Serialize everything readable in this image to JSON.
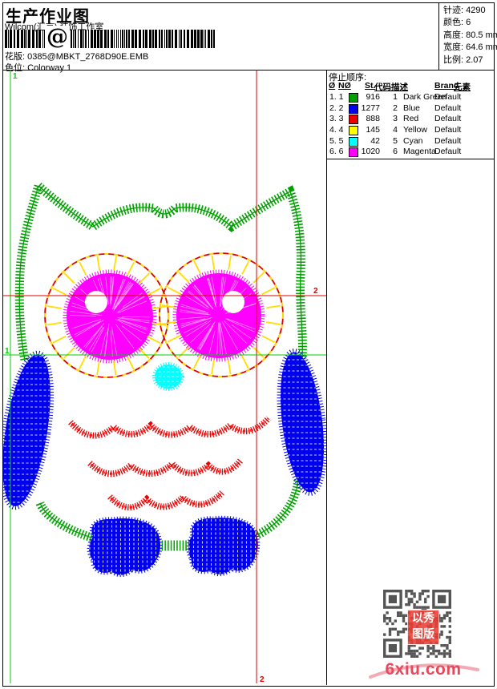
{
  "header": {
    "title": "生产作业图",
    "studio": "Wilcom(汇京) 装饰工作室",
    "barcode_text": "@",
    "pattern": {
      "label": "花版:",
      "value": "0385@MBKT_2768D90E.EMB"
    },
    "colorway": {
      "label": "色位:",
      "value": "Colorway 1"
    },
    "stats": [
      "针迹: 4290",
      "颜色: 6",
      "高度: 80.5 mm",
      "宽度: 64.6 mm",
      "比例: 2.07"
    ]
  },
  "stop_sequence": {
    "title": "停止顺序:",
    "columns": [
      "Ø",
      "NØ",
      "St.",
      "代码",
      "描述",
      "Brand",
      "元素"
    ],
    "rows": [
      {
        "seq": "1. 1",
        "swatch": "#00A000",
        "st": "916",
        "code": "1",
        "desc": "Dark Green",
        "brand": "Default",
        "element": ""
      },
      {
        "seq": "2. 2",
        "swatch": "#0000EE",
        "st": "1277",
        "code": "2",
        "desc": "Blue",
        "brand": "Default",
        "element": ""
      },
      {
        "seq": "3. 3",
        "swatch": "#EE0000",
        "st": "888",
        "code": "3",
        "desc": "Red",
        "brand": "Default",
        "element": ""
      },
      {
        "seq": "4. 4",
        "swatch": "#FFFF00",
        "st": "145",
        "code": "4",
        "desc": "Yellow",
        "brand": "Default",
        "element": ""
      },
      {
        "seq": "5. 5",
        "swatch": "#00FFFF",
        "st": "42",
        "code": "5",
        "desc": "Cyan",
        "brand": "Default",
        "element": ""
      },
      {
        "seq": "6. 6",
        "swatch": "#FF00FF",
        "st": "1020",
        "code": "6",
        "desc": "Magenta",
        "brand": "Default",
        "element": ""
      }
    ]
  },
  "design": {
    "guide_labels": {
      "v_green": "1",
      "h_green": "1",
      "h_red": "2",
      "v_red": "2"
    },
    "colors": {
      "green": "#00A000",
      "blue": "#0000EE",
      "red": "#EE0000",
      "yellow": "#FFDD00",
      "cyan": "#00FFFF",
      "magenta": "#FF00FF",
      "guide_green": "#00CC00",
      "guide_red": "#DD0000"
    }
  },
  "footer": {
    "stamp_line1": "以秀",
    "stamp_line2": "图版",
    "watermark": "6xiu.com",
    "watermark_color": "#e4495c"
  }
}
